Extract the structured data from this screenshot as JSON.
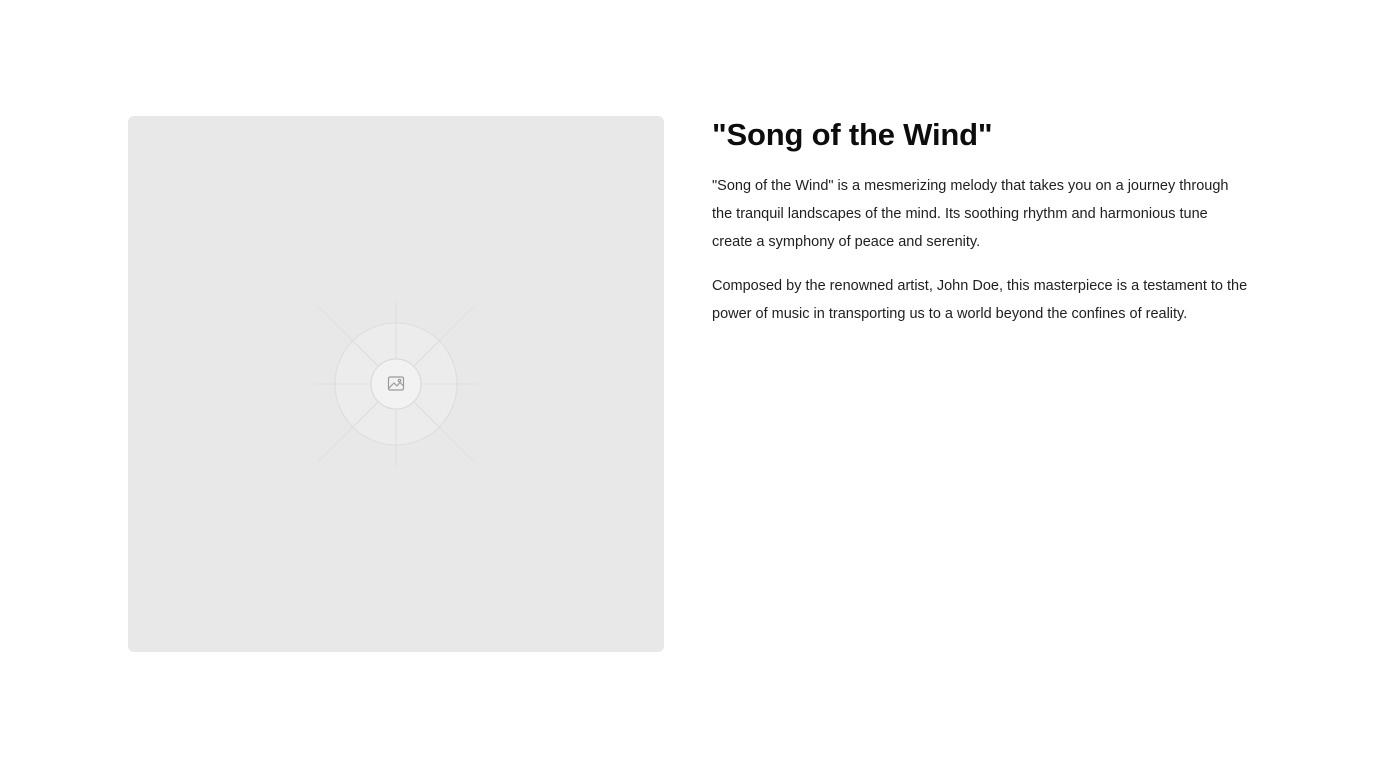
{
  "media": {
    "image_icon": "image-icon",
    "placeholder_color": "#e8e8e8"
  },
  "song": {
    "title": "\"Song of the Wind\"",
    "paragraphs": [
      "\"Song of the Wind\" is a mesmerizing melody that takes you on a journey through the tranquil landscapes of the mind. Its soothing rhythm and harmonious tune create a symphony of peace and serenity.",
      "Composed by the renowned artist, John Doe, this masterpiece is a testament to the power of music in transporting us to a world beyond the confines of reality."
    ]
  }
}
